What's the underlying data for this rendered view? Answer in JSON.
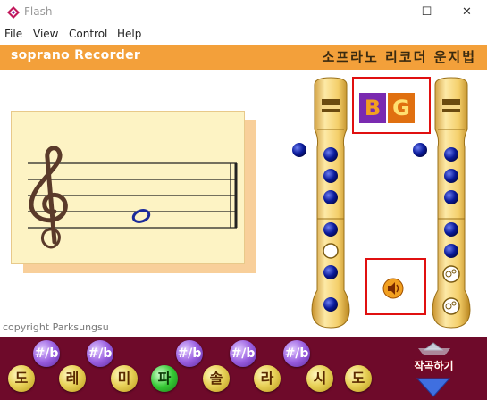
{
  "window": {
    "title": "Flash",
    "minimize_glyph": "—",
    "maximize_glyph": "☐",
    "close_glyph": "✕"
  },
  "menu": [
    "File",
    "View",
    "Control",
    "Help"
  ],
  "header": {
    "left_title": "soprano Recorder",
    "right_title": "소프라노 리코더 운지법"
  },
  "staff": {
    "clef": "treble",
    "note_position": "between-second-and-third-line"
  },
  "copyright": "copyright Parksungsu",
  "letters": [
    "B",
    "G"
  ],
  "notes": [
    "도",
    "레",
    "미",
    "파",
    "솔",
    "라",
    "시",
    "도"
  ],
  "active_note": "파",
  "sharp_flat_label": "#/b",
  "nav_label": "작곡하기",
  "colors": {
    "header_orange": "#f3a03a",
    "bottom_band": "#6e0a2a",
    "active_note_green": "#35c834",
    "hole_blue": "#0a1a9a",
    "highlight_red": "#e01010"
  },
  "icons": [
    "flash-app-icon",
    "speaker-icon",
    "down-arrow-icon",
    "up-arrow-icon"
  ]
}
